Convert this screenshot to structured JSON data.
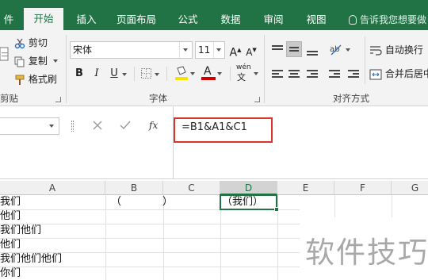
{
  "tabs": [
    {
      "label": "件",
      "active": false
    },
    {
      "label": "开始",
      "active": true
    },
    {
      "label": "插入",
      "active": false
    },
    {
      "label": "页面布局",
      "active": false
    },
    {
      "label": "公式",
      "active": false
    },
    {
      "label": "数据",
      "active": false
    },
    {
      "label": "审阅",
      "active": false
    },
    {
      "label": "视图",
      "active": false
    }
  ],
  "tell_me": "告诉我您想要做",
  "clipboard": {
    "cut": "剪切",
    "copy": "复制",
    "format_painter": "格式刷",
    "group": "剪贴板"
  },
  "font": {
    "name": "宋体",
    "size": "11",
    "grow": "A",
    "shrink": "A",
    "bold": "B",
    "italic": "I",
    "underline": "U",
    "font_color_letter": "A",
    "wen": "wén",
    "group": "字体"
  },
  "alignment": {
    "wrap": "自动换行",
    "merge": "合并后居中",
    "group": "对齐方式"
  },
  "formula_bar": {
    "fx": "fx",
    "formula": "=B1&A1&C1"
  },
  "columns": [
    "A",
    "B",
    "C",
    "D",
    "E",
    "F",
    "G"
  ],
  "cells": {
    "A": [
      "我们",
      "他们",
      "我们他们",
      "他们",
      "我们他们他们",
      "你们"
    ],
    "B1": "（",
    "C1": "）",
    "D1": "（我们）"
  },
  "watermark": "软件技巧",
  "colors": {
    "accent": "#217346",
    "highlight_border": "#d9342b",
    "fill_yellow": "#f5e400",
    "font_red": "#d00000"
  }
}
